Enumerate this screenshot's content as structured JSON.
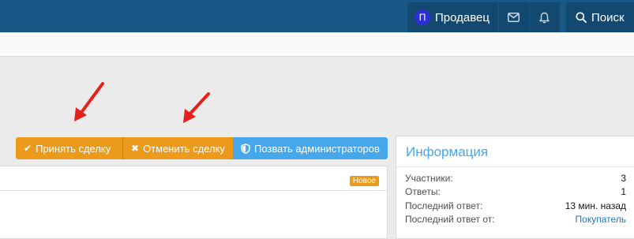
{
  "navbar": {
    "user": {
      "avatar_letter": "П",
      "name": "Продавец"
    },
    "icons": [
      "mail-icon",
      "bell-icon"
    ],
    "search_label": "Поиск"
  },
  "actions": {
    "accept_label": "Принять сделку",
    "cancel_label": "Отменить сделку",
    "admin_label": "Позвать администраторов"
  },
  "content": {
    "badge": "Новое"
  },
  "info": {
    "title": "Информация",
    "rows": [
      {
        "label": "Участники:",
        "value": "3"
      },
      {
        "label": "Ответы:",
        "value": "1"
      },
      {
        "label": "Последний ответ:",
        "value": "13 мин. назад"
      },
      {
        "label": "Последний ответ от:",
        "value": "Покупатель"
      }
    ]
  },
  "colors": {
    "navbar": "#185886",
    "navbar_group": "#14496f",
    "accent_orange": "#ec9a1b",
    "accent_blue": "#47a7eb",
    "arrow_red": "#e8201b"
  }
}
